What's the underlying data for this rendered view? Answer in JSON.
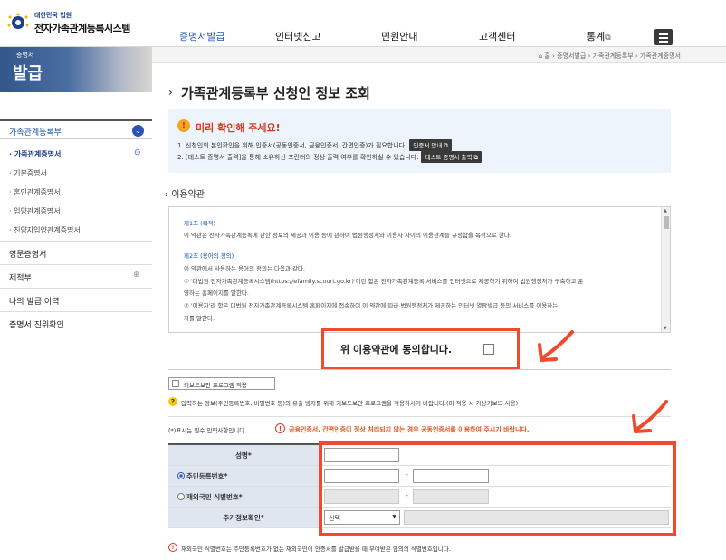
{
  "header": {
    "logo_small": "대한민국 법원",
    "logo_title": "전자가족관계등록시스템",
    "nav": [
      {
        "label": "증명서발급",
        "active": true
      },
      {
        "label": "인터넷신고"
      },
      {
        "label": "민원안내"
      },
      {
        "label": "고객센터"
      },
      {
        "label": "통계"
      }
    ]
  },
  "sidebar": {
    "banner_small": "증명서",
    "banner_big": "발급",
    "section": "가족관계등록부",
    "sub_items": [
      "· 가족관계증명서",
      "· 기본증명서",
      "· 혼인관계증명서",
      "· 입양관계증명서",
      "· 친양자입양관계증명서"
    ],
    "menu": [
      "영문증명서",
      "제적부",
      "나의 발급 이력",
      "증명서 진위확인"
    ]
  },
  "breadcrumb": "⌂ 홈 › 증명서발급 › 가족관계등록부 › 가족관계증명서",
  "page_title": "가족관계등록부 신청인 정보 조회",
  "notice": {
    "title": "미리 확인해 주세요!",
    "line1": "1. 신청인의 본인확인을 위해 인증서(공동인증서, 금융인증서, 간편인증)가 필요합니다.",
    "btn1": "인증서 안내 ⧉",
    "line2": "2. [테스트 증명서 출력]을 통해 소유하신 프린터의 정상 출력 여부를 확인하실 수 있습니다.",
    "btn2": "테스트 증명서 출력 ⧉"
  },
  "terms": {
    "section_title": "이용약관",
    "lines": [
      {
        "text": "제1조 (목적)",
        "head": true
      },
      {
        "text": "이 약관은 전자가족관계등록에 관한 정보의 제공과 이용 등에 관하여 법원행정처와 이용자 사이의 이용관계를 규정함을 목적으로 한다.",
        "head": false
      },
      {
        "text": "제2조 (용어의 정의)",
        "head": true
      },
      {
        "text": "이 약관에서 사용하는 용어의 정의는 다음과 같다.",
        "head": false
      },
      {
        "text": "① '대법원 전자가족관계등록시스템(https://efamily.scourt.go.kr)'이란 함은 전자가족관계등록 서비스를 인터넷으로 제공하기 위하여 법원행정처가 구축하고 운",
        "head": false
      },
      {
        "text": "영하는 홈페이지를 말한다.",
        "head": false
      },
      {
        "text": "② '이용자'라 함은 대법원 전자가족관계등록시스템 홈페이지에 접속하여 이 약관에 따라 법원행정처가 제공하는 인터넷 열람발급 등의 서비스를 이용하는",
        "head": false
      },
      {
        "text": "자를 말한다.",
        "head": false
      }
    ],
    "agree_label": "위 이용약관에 동의합니다."
  },
  "keyboard": {
    "button": "키보드보안 프로그램 적용",
    "note": "입력하는 정보(주민등록번호, 비밀번호 등)의 유출 방지를 위해 키보드보안 프로그램을 적용하시기 바랍니다.(미 적용 시 가상키보드 사용)"
  },
  "required_note": "(*)표시는 필수 입력사항입니다.",
  "warning_note": "금융인증서, 간편인증이 정상 처리되지 않는 경우 공동인증서를 이용하여 주시기 바랍니다.",
  "form": {
    "name_label": "성명*",
    "rrn_label": "주민등록번호*",
    "foreign_label": "재외국민 식별번호*",
    "extra_label": "추가정보확인*",
    "select_value": "선택",
    "dash": "-"
  },
  "footer_note": "재외국민 식별번호는 주민등록번호가 없는 재외국민이 인증서를 발급받을 때 부여받은 임의의 식별번호입니다.",
  "colors": {
    "accent": "#2a55b8",
    "highlight": "#ef4a2a"
  }
}
